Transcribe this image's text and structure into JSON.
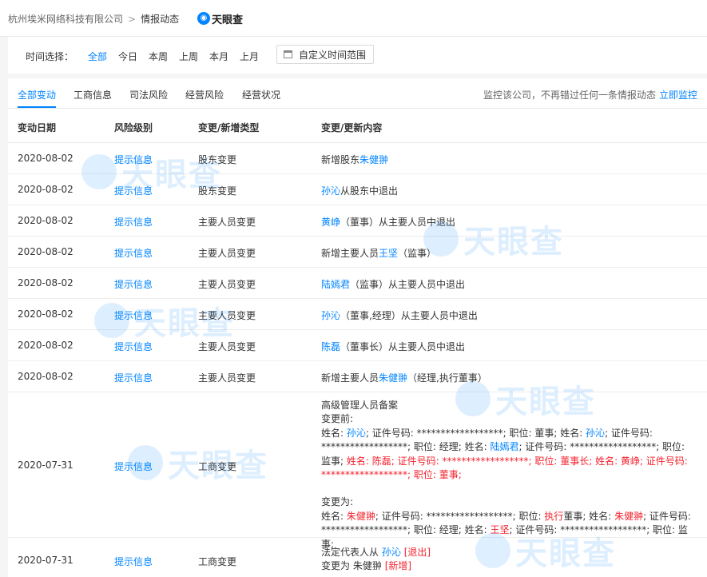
{
  "breadcrumb": {
    "company": "杭州埃米网络科技有限公司",
    "current": "情报动态",
    "sep": ">"
  },
  "logo": {
    "text": "天眼查"
  },
  "filter": {
    "label": "时间选择：",
    "options": [
      "全部",
      "今日",
      "本周",
      "上周",
      "本月",
      "上月"
    ],
    "custom_label": "自定义时间范围"
  },
  "tabs": [
    "全部变动",
    "工商信息",
    "司法风险",
    "经营风险",
    "经营状况"
  ],
  "promo": {
    "text": "监控该公司，不再错过任何一条情报动态",
    "link": "立即监控"
  },
  "columns": [
    "变动日期",
    "风险级别",
    "变更/新增类型",
    "变更/更新内容"
  ],
  "rows": [
    {
      "date": "2020-08-02",
      "risk": "提示信息",
      "type": "股东变更",
      "c": [
        "新增股东",
        "朱健翀"
      ]
    },
    {
      "date": "2020-08-02",
      "risk": "提示信息",
      "type": "股东变更",
      "c": [
        "孙沁",
        "从股东中退出"
      ]
    },
    {
      "date": "2020-08-02",
      "risk": "提示信息",
      "type": "主要人员变更",
      "c": [
        "黄峥",
        "（董事）从主要人员中退出"
      ]
    },
    {
      "date": "2020-08-02",
      "risk": "提示信息",
      "type": "主要人员变更",
      "c": [
        "新增主要人员",
        "王坚",
        "（监事）"
      ]
    },
    {
      "date": "2020-08-02",
      "risk": "提示信息",
      "type": "主要人员变更",
      "c": [
        "陆嫣君",
        "（监事）从主要人员中退出"
      ]
    },
    {
      "date": "2020-08-02",
      "risk": "提示信息",
      "type": "主要人员变更",
      "c": [
        "孙沁",
        "（董事,经理）从主要人员中退出"
      ]
    },
    {
      "date": "2020-08-02",
      "risk": "提示信息",
      "type": "主要人员变更",
      "c": [
        "陈磊",
        "（董事长）从主要人员中退出"
      ]
    },
    {
      "date": "2020-08-02",
      "risk": "提示信息",
      "type": "主要人员变更",
      "c": [
        "新增主要人员",
        "朱健翀",
        "（经理,执行董事）"
      ]
    },
    {
      "date": "2020-07-31",
      "risk": "提示信息",
      "type": "工商变更",
      "filing": {
        "title": "高级管理人员备案",
        "before_label": "变更前:",
        "after_label": "变更为:",
        "name_k": "姓名: ",
        "id_k": "; 证件号码: ",
        "pos_k": "; 职位: ",
        "stars": "******************",
        "sep": "; ",
        "before": [
          {
            "name": "孙沁",
            "pos": "董事"
          },
          {
            "name": "孙沁",
            "pos": "经理"
          },
          {
            "name": "陆嫣君",
            "pos": "监事"
          },
          {
            "name": "陈磊",
            "pos": "董事长"
          },
          {
            "name": "黄峥",
            "pos": "董事"
          }
        ],
        "after": [
          {
            "name": "朱健翀",
            "pos_hl": "执行",
            "pos": "董事"
          },
          {
            "name": "朱健翀",
            "pos": "经理"
          },
          {
            "name": "王坚",
            "pos": "监事"
          }
        ]
      }
    },
    {
      "date": "2020-07-31",
      "risk": "提示信息",
      "type": "工商变更",
      "legal": {
        "l1": "法定代表人从",
        "old": "孙沁",
        "old_tag": "[退出]",
        "l2": "变更为",
        "new": "朱健翀",
        "new_tag": "[新增]"
      }
    }
  ]
}
